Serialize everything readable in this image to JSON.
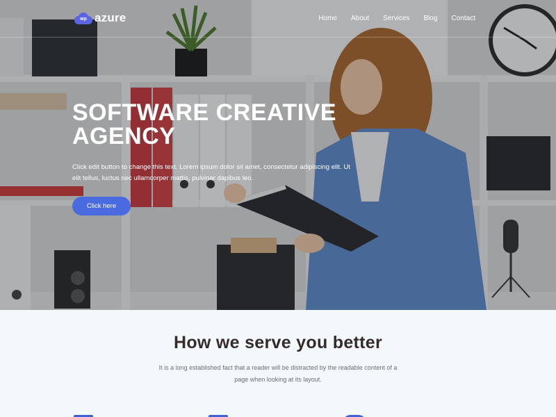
{
  "brand": {
    "badge": "wp",
    "name": "azure",
    "color": "#5b63e6"
  },
  "nav": {
    "items": [
      {
        "label": "Home"
      },
      {
        "label": "About"
      },
      {
        "label": "Services"
      },
      {
        "label": "Blog"
      },
      {
        "label": "Contact"
      }
    ]
  },
  "hero": {
    "title": "SOFTWARE CREATIVE AGENCY",
    "description": "Click edit button to change this text. Lorem ipsum dolor sit amet, consectetur adipiscing elit. Ut elit tellus, luctus nec ullamcorper mattis, pulvinar dapibus leo.",
    "button_label": "Click here",
    "button_color": "#4a6be0"
  },
  "services": {
    "title": "How we serve you better",
    "subtitle": "It is a long established fact that a reader will be distracted by the readable content of a page when looking at its layout.",
    "features": [
      {
        "icon": "feature-icon-1"
      },
      {
        "icon": "feature-icon-2"
      },
      {
        "icon": "feature-icon-3"
      }
    ]
  },
  "colors": {
    "accent": "#3f62d6",
    "section_bg": "#f3f8fb",
    "heading": "#362b2b"
  }
}
